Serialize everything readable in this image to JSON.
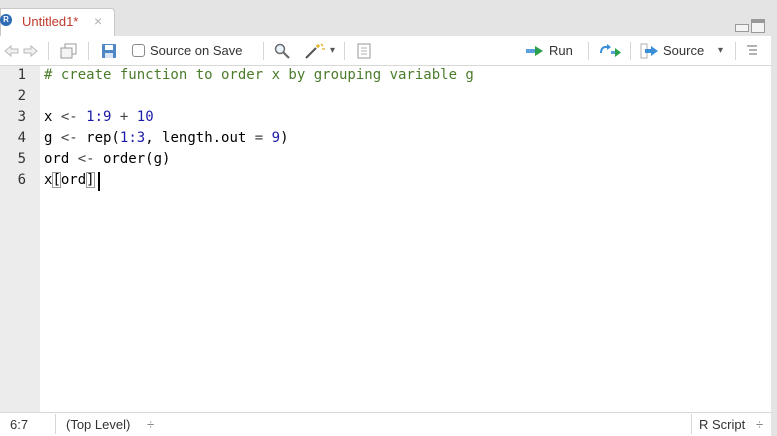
{
  "tab": {
    "title": "Untitled1*",
    "close_glyph": "×",
    "icon_letter": "R"
  },
  "toolbar": {
    "source_on_save": "Source on Save",
    "run": "Run",
    "source": "Source",
    "dropdown_glyph": "▾"
  },
  "editor": {
    "line_numbers": [
      "1",
      "2",
      "3",
      "4",
      "5",
      "6"
    ],
    "lines": {
      "l1": "# create function to order x by grouping variable g",
      "l3_a": "x ",
      "l3_b": "<-",
      "l3_c": " ",
      "l3_d": "1",
      "l3_e": ":",
      "l3_f": "9",
      "l3_g": " + ",
      "l3_h": "10",
      "l4_a": "g ",
      "l4_b": "<-",
      "l4_c": " rep(",
      "l4_d": "1",
      "l4_e": ":",
      "l4_f": "3",
      "l4_g": ", length.out ",
      "l4_h": "=",
      "l4_i": " ",
      "l4_j": "9",
      "l4_k": ")",
      "l5_a": "ord ",
      "l5_b": "<-",
      "l5_c": " order",
      "l5_d": "(",
      "l5_e": "g",
      "l5_f": ")",
      "l6_a": "x",
      "l6_b": "[",
      "l6_c": "ord",
      "l6_d": "]"
    }
  },
  "status": {
    "cursor_position": "6:7",
    "scope": "(Top Level)",
    "file_type": "R Script",
    "updown_glyph": "÷"
  },
  "colors": {
    "comment": "#4a7c2a",
    "number": "#1a1aa6",
    "tab_title": "#c0392b",
    "run_arrow": "#2aa04a",
    "source_arrow": "#3b8fd6"
  }
}
